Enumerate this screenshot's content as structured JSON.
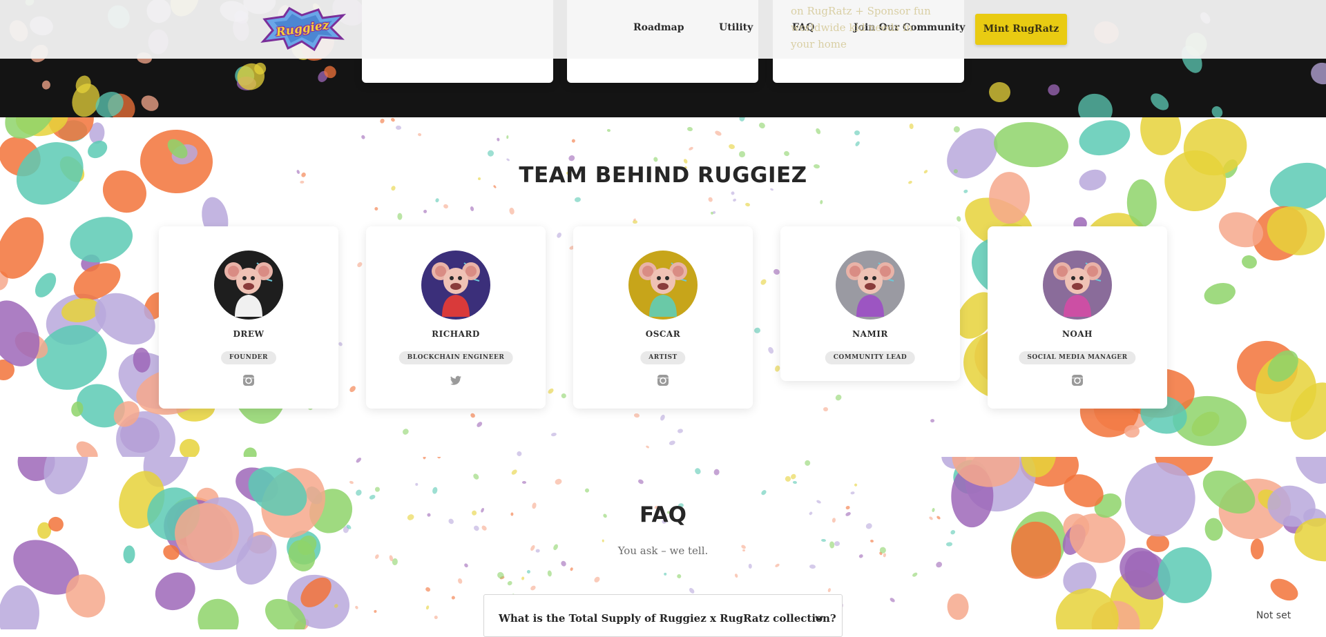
{
  "header": {
    "logo_alt": "Ruggiez",
    "nav": [
      {
        "label": "Roadmap"
      },
      {
        "label": "Utility"
      },
      {
        "label": "FAQ"
      },
      {
        "label": "Join Our Community"
      }
    ],
    "mint_button": "Mint RugRatz"
  },
  "roadmap_peek": {
    "text": "on RugRatz + Sponsor fun\nworldwide kid needs in\nyour home"
  },
  "team": {
    "title": "TEAM BEHIND RUGGIEZ",
    "members": [
      {
        "name": "DREW",
        "role": "FOUNDER",
        "social_icon": "instagram-icon",
        "avatar_bg": "#1e1e1e",
        "shirt": "#f0f0f0"
      },
      {
        "name": "RICHARD",
        "role": "BLOCKCHAIN ENGINEER",
        "social_icon": "twitter-icon",
        "avatar_bg": "#3b2f7a",
        "shirt": "#d93a3a"
      },
      {
        "name": "OSCAR",
        "role": "ARTIST",
        "social_icon": "instagram-icon",
        "avatar_bg": "#c7a51a",
        "shirt": "#6ac9a7"
      },
      {
        "name": "NAMIR",
        "role": "COMMUNITY LEAD",
        "social_icon": "none",
        "avatar_bg": "#9a9aa2",
        "shirt": "#9c55c2"
      },
      {
        "name": "NOAH",
        "role": "SOCIAL MEDIA MANAGER",
        "social_icon": "instagram-icon",
        "avatar_bg": "#8a6c9a",
        "shirt": "#cc4fa4"
      }
    ]
  },
  "faq": {
    "title": "FAQ",
    "subtitle": "You ask – we tell.",
    "items": [
      {
        "question": "What is the Total Supply of Ruggiez x RugRatz collection?"
      }
    ]
  },
  "status": {
    "label": "Not set"
  },
  "colors": {
    "accent": "#e9cb12",
    "dark_band": "#141414",
    "splatter": [
      "#f6a88c",
      "#e6d23a",
      "#5ccab4",
      "#b9a8dc",
      "#f2733a",
      "#8ed46a",
      "#9e67b8"
    ]
  }
}
